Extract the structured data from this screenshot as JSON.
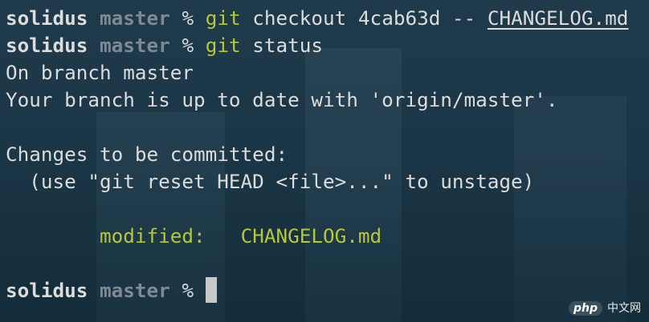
{
  "terminal": {
    "prompt": {
      "user": "solidus",
      "dir": "master",
      "symbol": "%"
    },
    "lines": {
      "l1": {
        "cmd": "git",
        "args": "checkout 4cab63d --",
        "file": "CHANGELOG.md"
      },
      "l2": {
        "cmd": "git",
        "args": "status"
      },
      "l3": "On branch master",
      "l4": "Your branch is up to date with 'origin/master'.",
      "l6": "Changes to be committed:",
      "l7": "  (use \"git reset HEAD <file>...\" to unstage)",
      "l9": {
        "label": "modified:",
        "file": "CHANGELOG.md"
      }
    }
  },
  "watermark": {
    "logo": "php",
    "text": "中文网"
  },
  "colors": {
    "background": "#1b3646",
    "text": "#dcdcdc",
    "host": "#7d8a93",
    "git_command": "#b6c83a",
    "cursor": "#c8c8c8"
  }
}
